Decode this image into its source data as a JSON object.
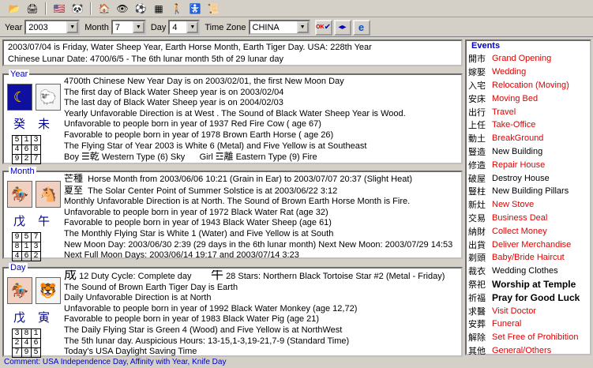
{
  "toolbar": {
    "buttons": [
      "open-icon",
      "print-icon",
      "us-flag-icon",
      "panda-icon",
      "house-icon",
      "eye-icon",
      "ball-icon",
      "grid-icon",
      "blue-figure-icon",
      "stroller-icon",
      "scholar-icon"
    ]
  },
  "selectors": {
    "year_label": "Year",
    "year_value": "2003",
    "month_label": "Month",
    "month_value": "7",
    "day_label": "Day",
    "day_value": "4",
    "tz_label": "Time Zone",
    "tz_value": "CHINA",
    "ok_label": "OK"
  },
  "info": {
    "line1": "2003/07/04 is Friday,  Water Sheep Year, Earth Horse Month, Earth Tiger Day.   USA: 228th Year",
    "line2": "Chinese Lunar Date: 4700/6/5 - The 6th lunar month 5th of 29 lunar day"
  },
  "year": {
    "title": "Year",
    "ganzhi": [
      "癸",
      "未"
    ],
    "grid": [
      [
        "5",
        "1",
        "3"
      ],
      [
        "4",
        "6",
        "8"
      ],
      [
        "9",
        "2",
        "7"
      ]
    ],
    "lines": [
      "4700th Chinese New Year Day is on 2003/02/01, the first New Moon Day",
      "The first day of Black Water Sheep year is on 2003/02/04",
      "The last day of Black Water Sheep year is on 2004/02/03",
      "Yearly Unfavorable Direction is at West .       The Sound of Black Water Sheep Year is Wood.",
      "Unfavorable to people born in year of 1937 Red Fire Cow ( age 67)",
      "Favorable to people born in year of 1978 Brown Earth Horse ( age 26)",
      "The Flying Star of Year 2003 is White 6 (Metal) and Five Yellow is at Southeast"
    ],
    "boy_label": "Boy",
    "boy_trigram": "☰乾",
    "boy_type": "Western Type (6) Sky",
    "girl_label": "Girl",
    "girl_trigram": "☲離",
    "girl_type": "Eastern Type (9) Fire"
  },
  "month": {
    "title": "Month",
    "ganzhi": [
      "戊",
      "午"
    ],
    "grid": [
      [
        "9",
        "5",
        "7"
      ],
      [
        "8",
        "1",
        "3"
      ],
      [
        "4",
        "6",
        "2"
      ]
    ],
    "term1_cn": "芒種",
    "term1": "Horse Month from 2003/06/06 10:21 (Grain in Ear) to 2003/07/07 20:37 (Slight Heat)",
    "term2_cn": "夏至",
    "term2": "The Solar Center Point of Summer Solstice is at 2003/06/22 3:12",
    "lines": [
      "Monthly Unfavorable Direction is at North.       The Sound of Brown Earth Horse Month is Fire.",
      "Unfavorable to people born in year of 1972 Black Water Rat (age 32)",
      "Favorable to people born in year of 1943 Black Water Sheep (age 61)",
      "The Monthly Flying Star is White 1 (Water) and Five Yellow is at South",
      "New Moon Day: 2003/06/30 2:39 (29 days in the 6th lunar month) Next New Moon: 2003/07/29 14:53",
      "Next Full Moon Days: 2003/06/14 19:17 and 2003/07/14 3:23"
    ]
  },
  "day": {
    "title": "Day",
    "ganzhi": [
      "戊",
      "寅"
    ],
    "grid": [
      [
        "3",
        "8",
        "1"
      ],
      [
        "2",
        "4",
        "6"
      ],
      [
        "7",
        "9",
        "5"
      ]
    ],
    "duty_cn": "成",
    "duty": "12 Duty Cycle: Complete day",
    "star_cn": "牛",
    "star": "28 Stars: Northern Black Tortoise Star #2 (Metal -  Friday)",
    "lines": [
      "The Sound of Brown Earth Tiger Day is Earth",
      "Daily Unfavorable Direction is at North",
      "Unfavorable to people born in year of 1992 Black Water Monkey (age 12,72)",
      "Favorable to people born in year of 1983 Black Water Pig (age 21)",
      "The Daily Flying Star is Green 4 (Wood) and Five Yellow is at NorthWest",
      "The 5th lunar day. Auspicious Hours: 13-15,1-3,19-21,7-9 (Standard Time)",
      "Today's USA Daylight Saving Time"
    ]
  },
  "comment": "Comment: USA Independence Day, Affinity with Year, Knife Day",
  "events": {
    "title": "Events",
    "items": [
      {
        "cn": "開市",
        "en": "Grand Opening",
        "style": "red"
      },
      {
        "cn": "嫁娶",
        "en": "Wedding",
        "style": "red"
      },
      {
        "cn": "入宅",
        "en": "Relocation (Moving)",
        "style": "red"
      },
      {
        "cn": "安床",
        "en": "Moving Bed",
        "style": "red"
      },
      {
        "cn": "出行",
        "en": "Travel",
        "style": "red"
      },
      {
        "cn": "上任",
        "en": "Take-Office",
        "style": "red"
      },
      {
        "cn": "動土",
        "en": "BreakGround",
        "style": "red"
      },
      {
        "cn": "豎造",
        "en": "New Building",
        "style": "black"
      },
      {
        "cn": "修造",
        "en": "Repair House",
        "style": "red"
      },
      {
        "cn": "破屋",
        "en": "Destroy House",
        "style": "black"
      },
      {
        "cn": "豎柱",
        "en": "New Building Pillars",
        "style": "black"
      },
      {
        "cn": "新灶",
        "en": "New Stove",
        "style": "red"
      },
      {
        "cn": "交易",
        "en": "Business Deal",
        "style": "red"
      },
      {
        "cn": "納財",
        "en": "Collect Money",
        "style": "red"
      },
      {
        "cn": "出貨",
        "en": "Deliver Merchandise",
        "style": "red"
      },
      {
        "cn": "剃頭",
        "en": "Baby/Bride Haircut",
        "style": "red"
      },
      {
        "cn": "裁衣",
        "en": "Wedding Clothes",
        "style": "black"
      },
      {
        "cn": "祭祀",
        "en": "Worship at Temple",
        "style": "bold"
      },
      {
        "cn": "祈福",
        "en": "Pray for Good Luck",
        "style": "bold"
      },
      {
        "cn": "求醫",
        "en": "Visit Doctor",
        "style": "red"
      },
      {
        "cn": "安葬",
        "en": "Funeral",
        "style": "red"
      },
      {
        "cn": "解除",
        "en": "Set Free of Prohibition",
        "style": "red"
      },
      {
        "cn": "其他",
        "en": "General/Others",
        "style": "red"
      }
    ]
  }
}
